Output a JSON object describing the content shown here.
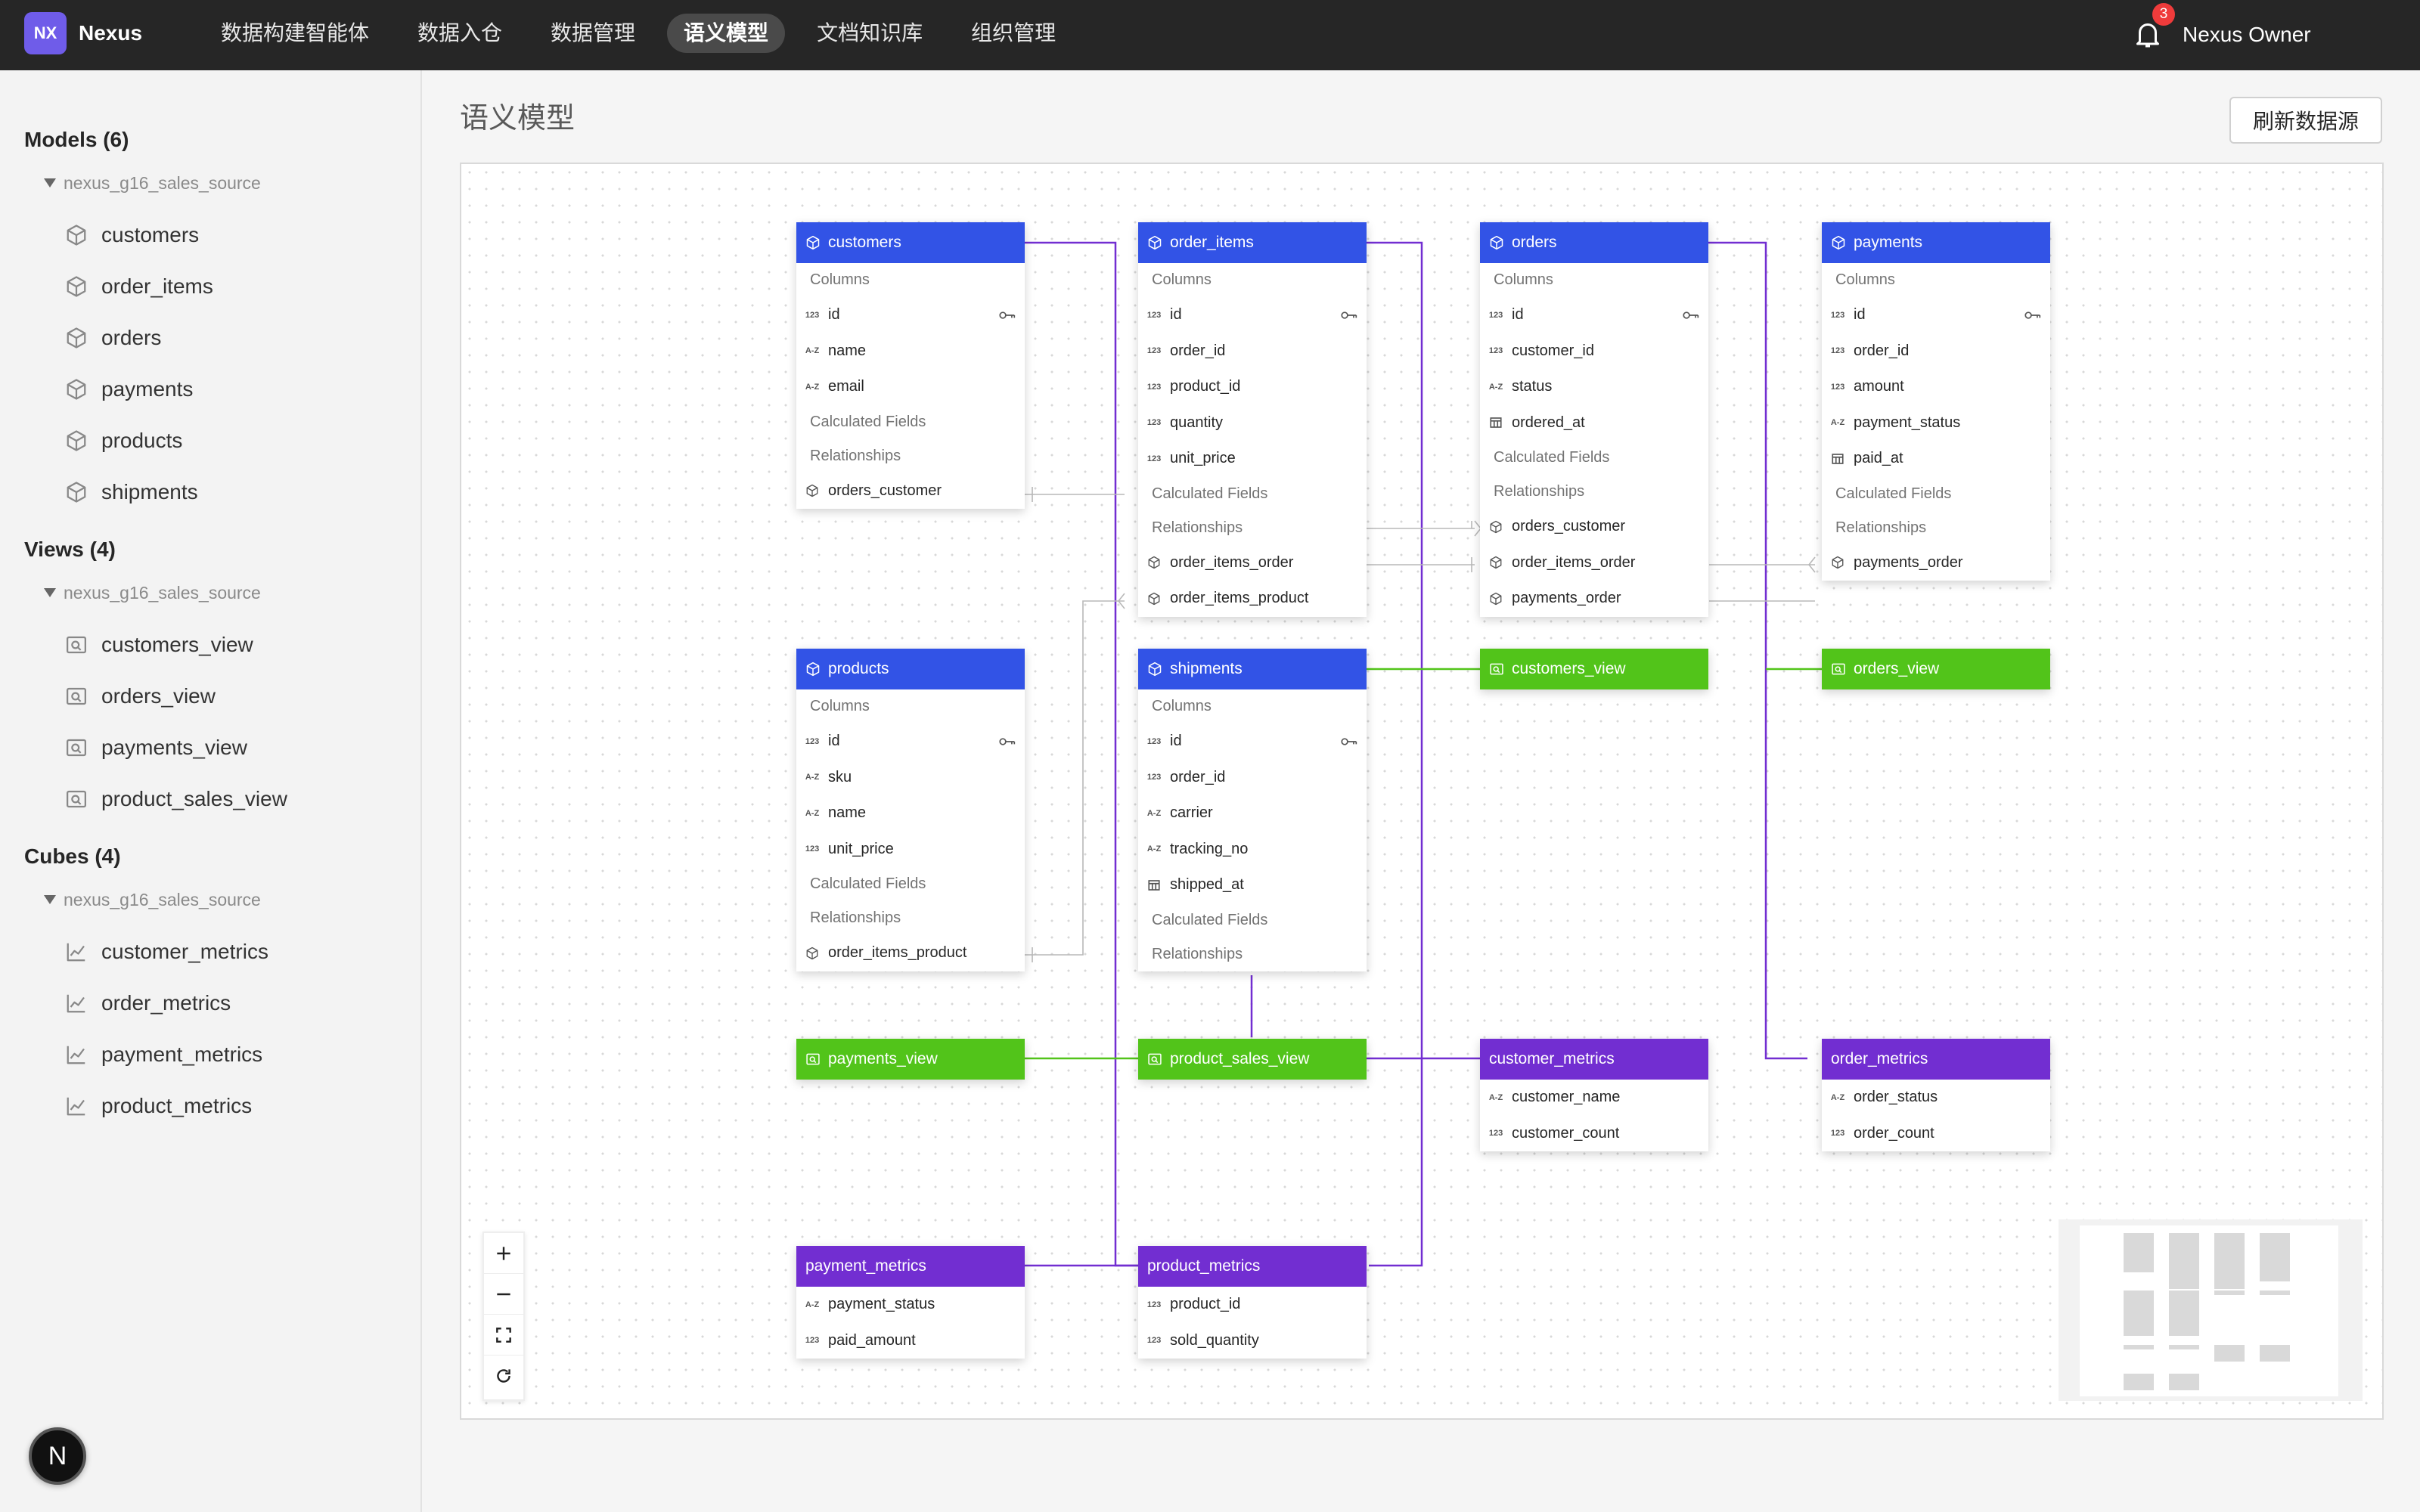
{
  "app": {
    "logo": "NX",
    "brand": "Nexus",
    "user": "Nexus Owner",
    "notification_count": "3"
  },
  "nav": [
    "数据构建智能体",
    "数据入仓",
    "数据管理",
    "语义模型",
    "文档知识库",
    "组织管理"
  ],
  "nav_active": "语义模型",
  "sidebar": {
    "models": {
      "title": "Models (6)",
      "source": "nexus_g16_sales_source",
      "items": [
        "customers",
        "order_items",
        "orders",
        "payments",
        "products",
        "shipments"
      ]
    },
    "views": {
      "title": "Views (4)",
      "source": "nexus_g16_sales_source",
      "items": [
        "customers_view",
        "orders_view",
        "payments_view",
        "product_sales_view"
      ]
    },
    "cubes": {
      "title": "Cubes (4)",
      "source": "nexus_g16_sales_source",
      "items": [
        "customer_metrics",
        "order_metrics",
        "payment_metrics",
        "product_metrics"
      ]
    }
  },
  "main": {
    "title": "语义模型",
    "refresh_label": "刷新数据源"
  },
  "labels": {
    "columns": "Columns",
    "calculated": "Calculated Fields",
    "relationships": "Relationships"
  },
  "nodes": {
    "customers": {
      "title": "customers",
      "fields": [
        "id",
        "name",
        "email"
      ],
      "rels": [
        "orders_customer"
      ]
    },
    "order_items": {
      "title": "order_items",
      "fields": [
        "id",
        "order_id",
        "product_id",
        "quantity",
        "unit_price"
      ],
      "rels": [
        "order_items_order",
        "order_items_product"
      ]
    },
    "orders": {
      "title": "orders",
      "fields": [
        "id",
        "customer_id",
        "status",
        "ordered_at"
      ],
      "rels": [
        "orders_customer",
        "order_items_order",
        "payments_order"
      ]
    },
    "payments": {
      "title": "payments",
      "fields": [
        "id",
        "order_id",
        "amount",
        "payment_status",
        "paid_at"
      ],
      "rels": [
        "payments_order"
      ]
    },
    "products": {
      "title": "products",
      "fields": [
        "id",
        "sku",
        "name",
        "unit_price"
      ],
      "rels": [
        "order_items_product"
      ]
    },
    "shipments": {
      "title": "shipments",
      "fields": [
        "id",
        "order_id",
        "carrier",
        "tracking_no",
        "shipped_at"
      ]
    },
    "customers_view": {
      "title": "customers_view"
    },
    "orders_view": {
      "title": "orders_view"
    },
    "payments_view": {
      "title": "payments_view"
    },
    "product_sales_view": {
      "title": "product_sales_view"
    },
    "customer_metrics": {
      "title": "customer_metrics",
      "fields": [
        "customer_name",
        "customer_count"
      ]
    },
    "order_metrics": {
      "title": "order_metrics",
      "fields": [
        "order_status",
        "order_count"
      ]
    },
    "payment_metrics": {
      "title": "payment_metrics",
      "fields": [
        "payment_status",
        "paid_amount"
      ]
    },
    "product_metrics": {
      "title": "product_metrics",
      "fields": [
        "product_id",
        "sold_quantity"
      ]
    }
  },
  "colors": {
    "model": "#3253e6",
    "view": "#52c41a",
    "cube": "#722ed1"
  },
  "assistant": "N"
}
